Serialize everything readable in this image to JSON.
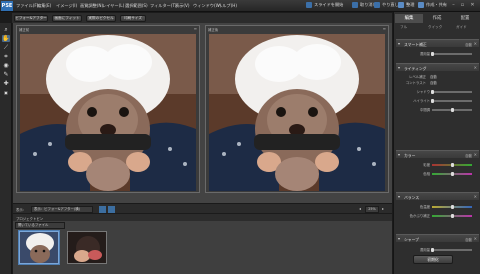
{
  "app": {
    "logo": "PSE"
  },
  "menu": [
    "ファイル(F)",
    "編集(E)",
    "イメージ(I)",
    "画質調整(N)",
    "レイヤー(L)",
    "選択範囲(S)",
    "フィルター(T)",
    "表示(V)",
    "ウィンドウ(W)",
    "ヘルプ(H)"
  ],
  "toolbar_right": [
    {
      "label": "スライドを開始",
      "icon": "slideshow-icon",
      "color": "#3b6fa8"
    },
    {
      "label": "取り消し",
      "icon": "undo-icon",
      "color": "#3b6fa8"
    },
    {
      "label": "やり直し",
      "icon": "redo-icon",
      "color": "#3b6fa8"
    },
    {
      "label": "整理",
      "icon": "organize-icon",
      "color": "#5a8bc4"
    },
    {
      "label": "作成・共有",
      "icon": "create-share-icon",
      "color": "#5a8bc4"
    }
  ],
  "options_bar": [
    "ビフォー&アフター",
    "画面にフィット",
    "実際のピクセル",
    "印刷サイズ"
  ],
  "canvas": {
    "before_label": "補正前",
    "after_label": "補正後"
  },
  "status_bar": {
    "view_select": "表示：ビフォー&アフター(横)",
    "zoom": "25%"
  },
  "bin": {
    "header": "プロジェクトビン",
    "select": "開いているファイル"
  },
  "panel": {
    "tabs": [
      "編集",
      "作成",
      "配置"
    ],
    "active_tab": 0,
    "subtabs": [
      "フル",
      "クイック",
      "ガイド"
    ],
    "sections": [
      {
        "title": "スマート補正",
        "auto": "自動",
        "sliders": [
          {
            "label": "適用量",
            "value": 0.0
          }
        ]
      },
      {
        "title": "ライティング",
        "auto": "",
        "texts": [
          {
            "label": "レベル補正",
            "value": "自動"
          },
          {
            "label": "コントラスト",
            "value": "自動"
          }
        ],
        "sliders": [
          {
            "label": "シャドウ",
            "value": 0.0
          },
          {
            "label": "ハイライト",
            "value": 0.0
          },
          {
            "label": "中間調",
            "value": 0.5
          }
        ]
      },
      {
        "title": "カラー",
        "auto": "自動",
        "sliders": [
          {
            "label": "彩度",
            "value": 0.5
          },
          {
            "label": "色相",
            "value": 0.5
          }
        ]
      },
      {
        "title": "バランス",
        "auto": "",
        "sliders": [
          {
            "label": "色温度",
            "value": 0.5
          },
          {
            "label": "色かぶり補正",
            "value": 0.5
          }
        ]
      },
      {
        "title": "シャープ",
        "auto": "自動",
        "sliders": [
          {
            "label": "適用量",
            "value": 0.0
          }
        ]
      }
    ],
    "reset_button": "初期化"
  },
  "colors": {
    "accent": "#4a6b8c",
    "panel_bg": "#2e2e2e",
    "canvas_bg": "#434343"
  }
}
